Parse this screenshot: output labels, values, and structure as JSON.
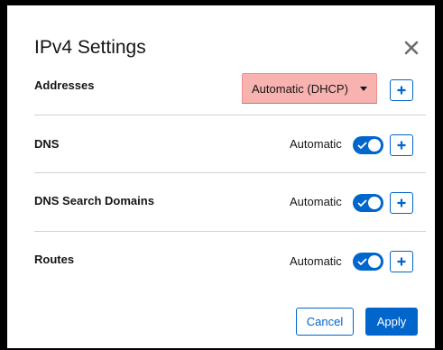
{
  "dialog": {
    "title": "IPv4 Settings",
    "close_icon": "close-icon"
  },
  "addresses": {
    "label": "Addresses",
    "method_selected": "Automatic (DHCP)",
    "add_icon": "plus-icon"
  },
  "dns": {
    "label": "DNS",
    "toggle_label": "Automatic",
    "toggle_on": true,
    "add_icon": "plus-icon"
  },
  "dns_search": {
    "label": "DNS Search Domains",
    "toggle_label": "Automatic",
    "toggle_on": true,
    "add_icon": "plus-icon"
  },
  "routes": {
    "label": "Routes",
    "toggle_label": "Automatic",
    "toggle_on": true,
    "add_icon": "plus-icon"
  },
  "footer": {
    "cancel_label": "Cancel",
    "apply_label": "Apply"
  },
  "colors": {
    "accent": "#0066cc",
    "select_highlight": "#f8b3b0",
    "frame": "#000000"
  }
}
